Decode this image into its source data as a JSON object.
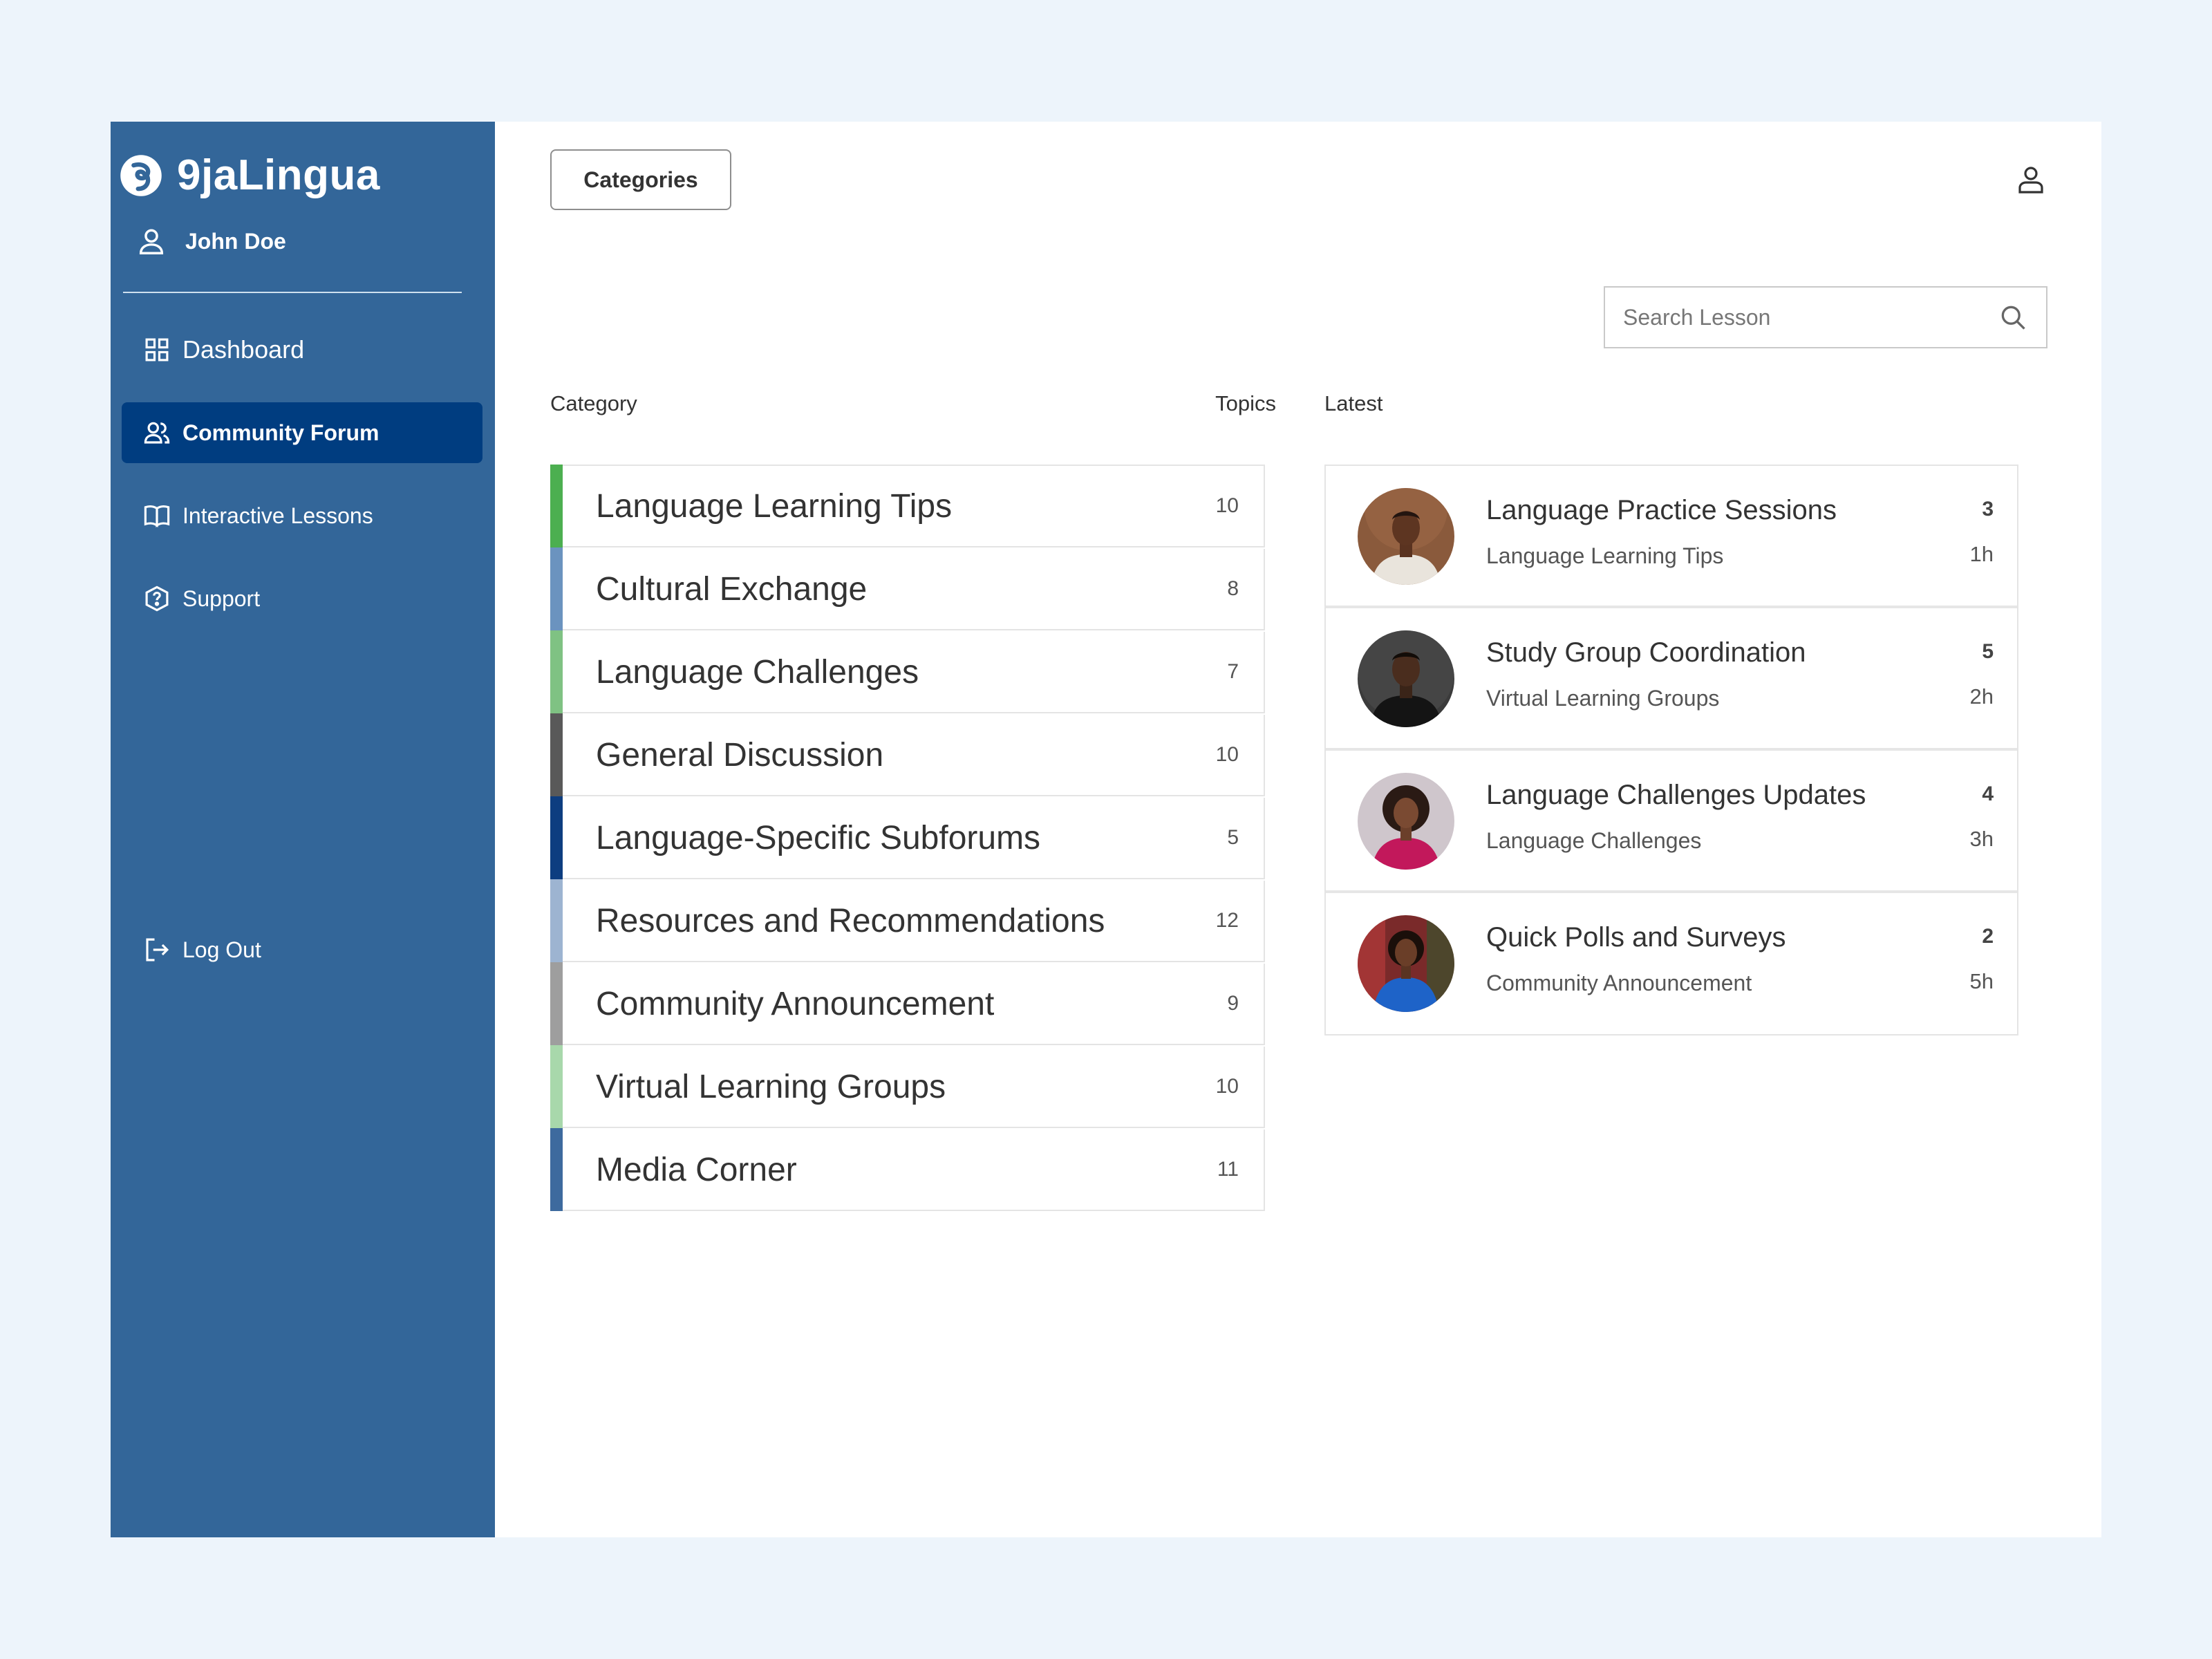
{
  "app": {
    "brand_name": "9jaLingua",
    "user_name": "John Doe"
  },
  "sidebar": {
    "items": [
      {
        "label": "Dashboard",
        "icon": "grid-icon",
        "active": false
      },
      {
        "label": "Community Forum",
        "icon": "users-icon",
        "active": true
      },
      {
        "label": "Interactive Lessons",
        "icon": "book-icon",
        "active": false
      },
      {
        "label": "Support",
        "icon": "help-icon",
        "active": false
      }
    ],
    "logout_label": "Log Out"
  },
  "header": {
    "categories_label": "Categories"
  },
  "search": {
    "placeholder": "Search Lesson"
  },
  "table_headers": {
    "category": "Category",
    "topics": "Topics",
    "latest": "Latest"
  },
  "categories": [
    {
      "name": "Language Learning Tips",
      "topics": "10",
      "color": "#4caf50"
    },
    {
      "name": "Cultural Exchange",
      "topics": "8",
      "color": "#6b93bf"
    },
    {
      "name": "Language Challenges",
      "topics": "7",
      "color": "#7fc283"
    },
    {
      "name": "General Discussion",
      "topics": "10",
      "color": "#595959"
    },
    {
      "name": "Language-Specific Subforums",
      "topics": "5",
      "color": "#0d3d80"
    },
    {
      "name": "Resources and Recommendations",
      "topics": "12",
      "color": "#9db4d1"
    },
    {
      "name": "Community Announcement",
      "topics": "9",
      "color": "#9e9e9e"
    },
    {
      "name": "Virtual Learning Groups",
      "topics": "10",
      "color": "#a8d8ab"
    },
    {
      "name": "Media Corner",
      "topics": "11",
      "color": "#3d6a9e"
    }
  ],
  "latest": [
    {
      "title": "Language Practice Sessions",
      "category": "Language Learning Tips",
      "count": "3",
      "time": "1h",
      "avatar": "avatar-man-brown-background"
    },
    {
      "title": "Study Group Coordination",
      "category": "Virtual Learning Groups",
      "count": "5",
      "time": "2h",
      "avatar": "avatar-man-dark-background"
    },
    {
      "title": "Language Challenges Updates",
      "category": "Language Challenges",
      "count": "4",
      "time": "3h",
      "avatar": "avatar-woman-pink-top"
    },
    {
      "title": "Quick Polls and Surveys",
      "category": "Community Announcement",
      "count": "2",
      "time": "5h",
      "avatar": "avatar-woman-blue-top"
    }
  ],
  "colors": {
    "sidebar_bg": "#336699",
    "active_nav_bg": "#003d80",
    "page_bg": "#edf4fb"
  }
}
